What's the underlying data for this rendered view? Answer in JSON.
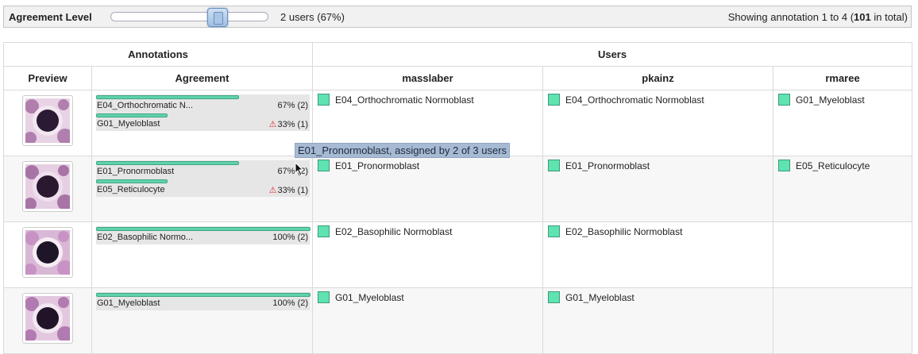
{
  "topbar": {
    "label": "Agreement Level",
    "slider_value": "2 users (67%)",
    "showing_prefix": "Showing annotation 1 to 4 (",
    "showing_total": "101",
    "showing_suffix": " in total)"
  },
  "table": {
    "group_annotations": "Annotations",
    "group_users": "Users",
    "col_preview": "Preview",
    "col_agreement": "Agreement",
    "users": [
      "masslaber",
      "pkainz",
      "rmaree"
    ]
  },
  "rows": [
    {
      "agreement": [
        {
          "name": "E04_Orthochromatic N...",
          "pct": "67% (2)",
          "fraction": 0.67,
          "warn": false
        },
        {
          "name": "G01_Myeloblast",
          "pct": "33% (1)",
          "fraction": 0.33,
          "warn": true
        }
      ],
      "cells": [
        "E04_Orthochromatic Normoblast",
        "E04_Orthochromatic Normoblast",
        "G01_Myeloblast"
      ]
    },
    {
      "agreement": [
        {
          "name": "E01_Pronormoblast",
          "pct": "67% (2)",
          "fraction": 0.67,
          "warn": false
        },
        {
          "name": "E05_Reticulocyte",
          "pct": "33% (1)",
          "fraction": 0.33,
          "warn": true
        }
      ],
      "cells": [
        "E01_Pronormoblast",
        "E01_Pronormoblast",
        "E05_Reticulocyte"
      ]
    },
    {
      "agreement": [
        {
          "name": "E02_Basophilic Normo...",
          "pct": "100% (2)",
          "fraction": 1.0,
          "warn": false
        }
      ],
      "cells": [
        "E02_Basophilic Normoblast",
        "E02_Basophilic Normoblast",
        ""
      ]
    },
    {
      "agreement": [
        {
          "name": "G01_Myeloblast",
          "pct": "100% (2)",
          "fraction": 1.0,
          "warn": false
        }
      ],
      "cells": [
        "G01_Myeloblast",
        "G01_Myeloblast",
        ""
      ]
    }
  ],
  "tooltip": "E01_Pronormoblast, assigned by 2 of 3 users",
  "colors": {
    "swatch": "#5fe3b1",
    "bar": "#5fd3a9",
    "warning": "#dd3333",
    "tooltip_bg": "#a7bad3"
  },
  "icons": {
    "warning": "warning-triangle-icon",
    "cursor": "mouse-cursor-icon"
  }
}
